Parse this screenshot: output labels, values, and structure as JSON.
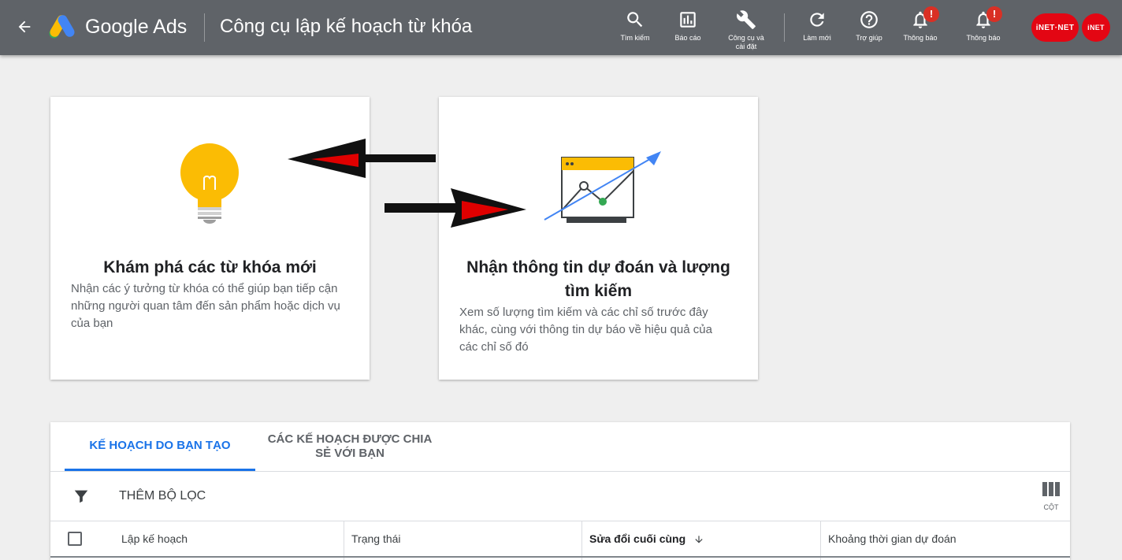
{
  "header": {
    "brand": "Google Ads",
    "page_title": "Công cụ lập kế hoạch từ khóa",
    "tools": [
      {
        "icon": "search-icon",
        "label": "Tìm kiếm"
      },
      {
        "icon": "reports-icon",
        "label": "Báo cáo"
      },
      {
        "icon": "wrench-icon",
        "label": "Công cụ và cài đặt"
      },
      {
        "icon": "refresh-icon",
        "label": "Làm mới"
      },
      {
        "icon": "help-icon",
        "label": "Trợ giúp"
      },
      {
        "icon": "bell-icon",
        "label": "Thông báo",
        "badge": "!"
      },
      {
        "icon": "bell-icon",
        "label": "Thông báo",
        "badge": "!"
      }
    ],
    "avatars": [
      "iNET·NET",
      "iNET"
    ]
  },
  "cards": [
    {
      "icon": "lightbulb-icon",
      "title": "Khám phá các từ khóa mới",
      "description": "Nhận các ý tưởng từ khóa có thể giúp bạn tiếp cận những người quan tâm đến sản phẩm hoặc dịch vụ của bạn"
    },
    {
      "icon": "forecast-chart-icon",
      "title": "Nhận thông tin dự đoán và lượng tìm kiếm",
      "description": "Xem số lượng tìm kiếm và các chỉ số trước đây khác, cùng với thông tin dự báo về hiệu quả của các chỉ số đó"
    }
  ],
  "plans": {
    "tabs": [
      "KẾ HOẠCH DO BẠN TẠO",
      "CÁC KẾ HOẠCH ĐƯỢC CHIA SẺ VỚI BẠN"
    ],
    "filter_label": "THÊM BỘ LỌC",
    "columns_label": "CỘT",
    "headers": [
      "Lập kế hoạch",
      "Trạng thái",
      "Sửa đổi cuối cùng",
      "Khoảng thời gian dự đoán"
    ]
  },
  "colors": {
    "header_bg": "#5f6368",
    "accent": "#1a73e8",
    "bulb": "#fbbc04",
    "badge": "#d93025",
    "avatar": "#e30613"
  }
}
